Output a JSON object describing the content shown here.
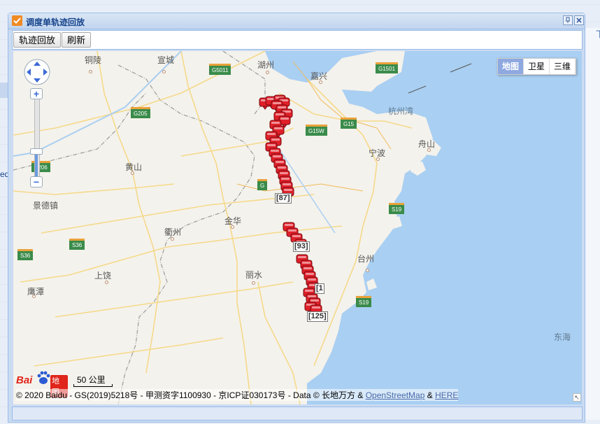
{
  "window": {
    "title": "调度单轨迹回放",
    "pin_icon": "pin-icon",
    "close_icon": "close-icon"
  },
  "background": {
    "side_link": "下",
    "left_tag": "ed"
  },
  "toolbar": {
    "playback_label": "轨迹回放",
    "refresh_label": "刷新"
  },
  "map": {
    "type_buttons": [
      "地图",
      "卫星",
      "三维"
    ],
    "active_type": "地图",
    "cities": [
      {
        "name": "铜陵"
      },
      {
        "name": "宣城"
      },
      {
        "name": "湖州"
      },
      {
        "name": "嘉兴"
      },
      {
        "name": "杭州湾"
      },
      {
        "name": "舟山"
      },
      {
        "name": "宁波"
      },
      {
        "name": "黄山"
      },
      {
        "name": "景德镇"
      },
      {
        "name": "衢州"
      },
      {
        "name": "金华"
      },
      {
        "name": "台州"
      },
      {
        "name": "丽水"
      },
      {
        "name": "上饶"
      },
      {
        "name": "鹰潭"
      }
    ],
    "sea_label": "东海",
    "highways": [
      "G5011",
      "G1501",
      "G205",
      "G15",
      "G15W",
      "S206",
      "G",
      "S19",
      "S36",
      "S36",
      "S19"
    ],
    "markers": [
      {
        "label": "[87]"
      },
      {
        "label": "[93]"
      },
      {
        "label": "[125]"
      },
      {
        "label": "[1"
      }
    ],
    "logo_text": "Bai",
    "logo_suffix": "地图",
    "scale_label": "50 公里",
    "copyright_prefix": "© 2020 Baidu - GS(2019)5218号 - 甲测资字1100930 - 京ICP证030173号 - Data © 长地万方 & ",
    "osm_link": "OpenStreetMap",
    "amp": " & ",
    "here_link": "HERE",
    "zoom_in": "+",
    "zoom_out": "−",
    "corner_icon": "↖"
  },
  "colors": {
    "accent": "#f08a24",
    "title_text": "#15428b",
    "marker_red": "#e0202a",
    "water": "#a9cff2",
    "land": "#f4f2ec"
  }
}
